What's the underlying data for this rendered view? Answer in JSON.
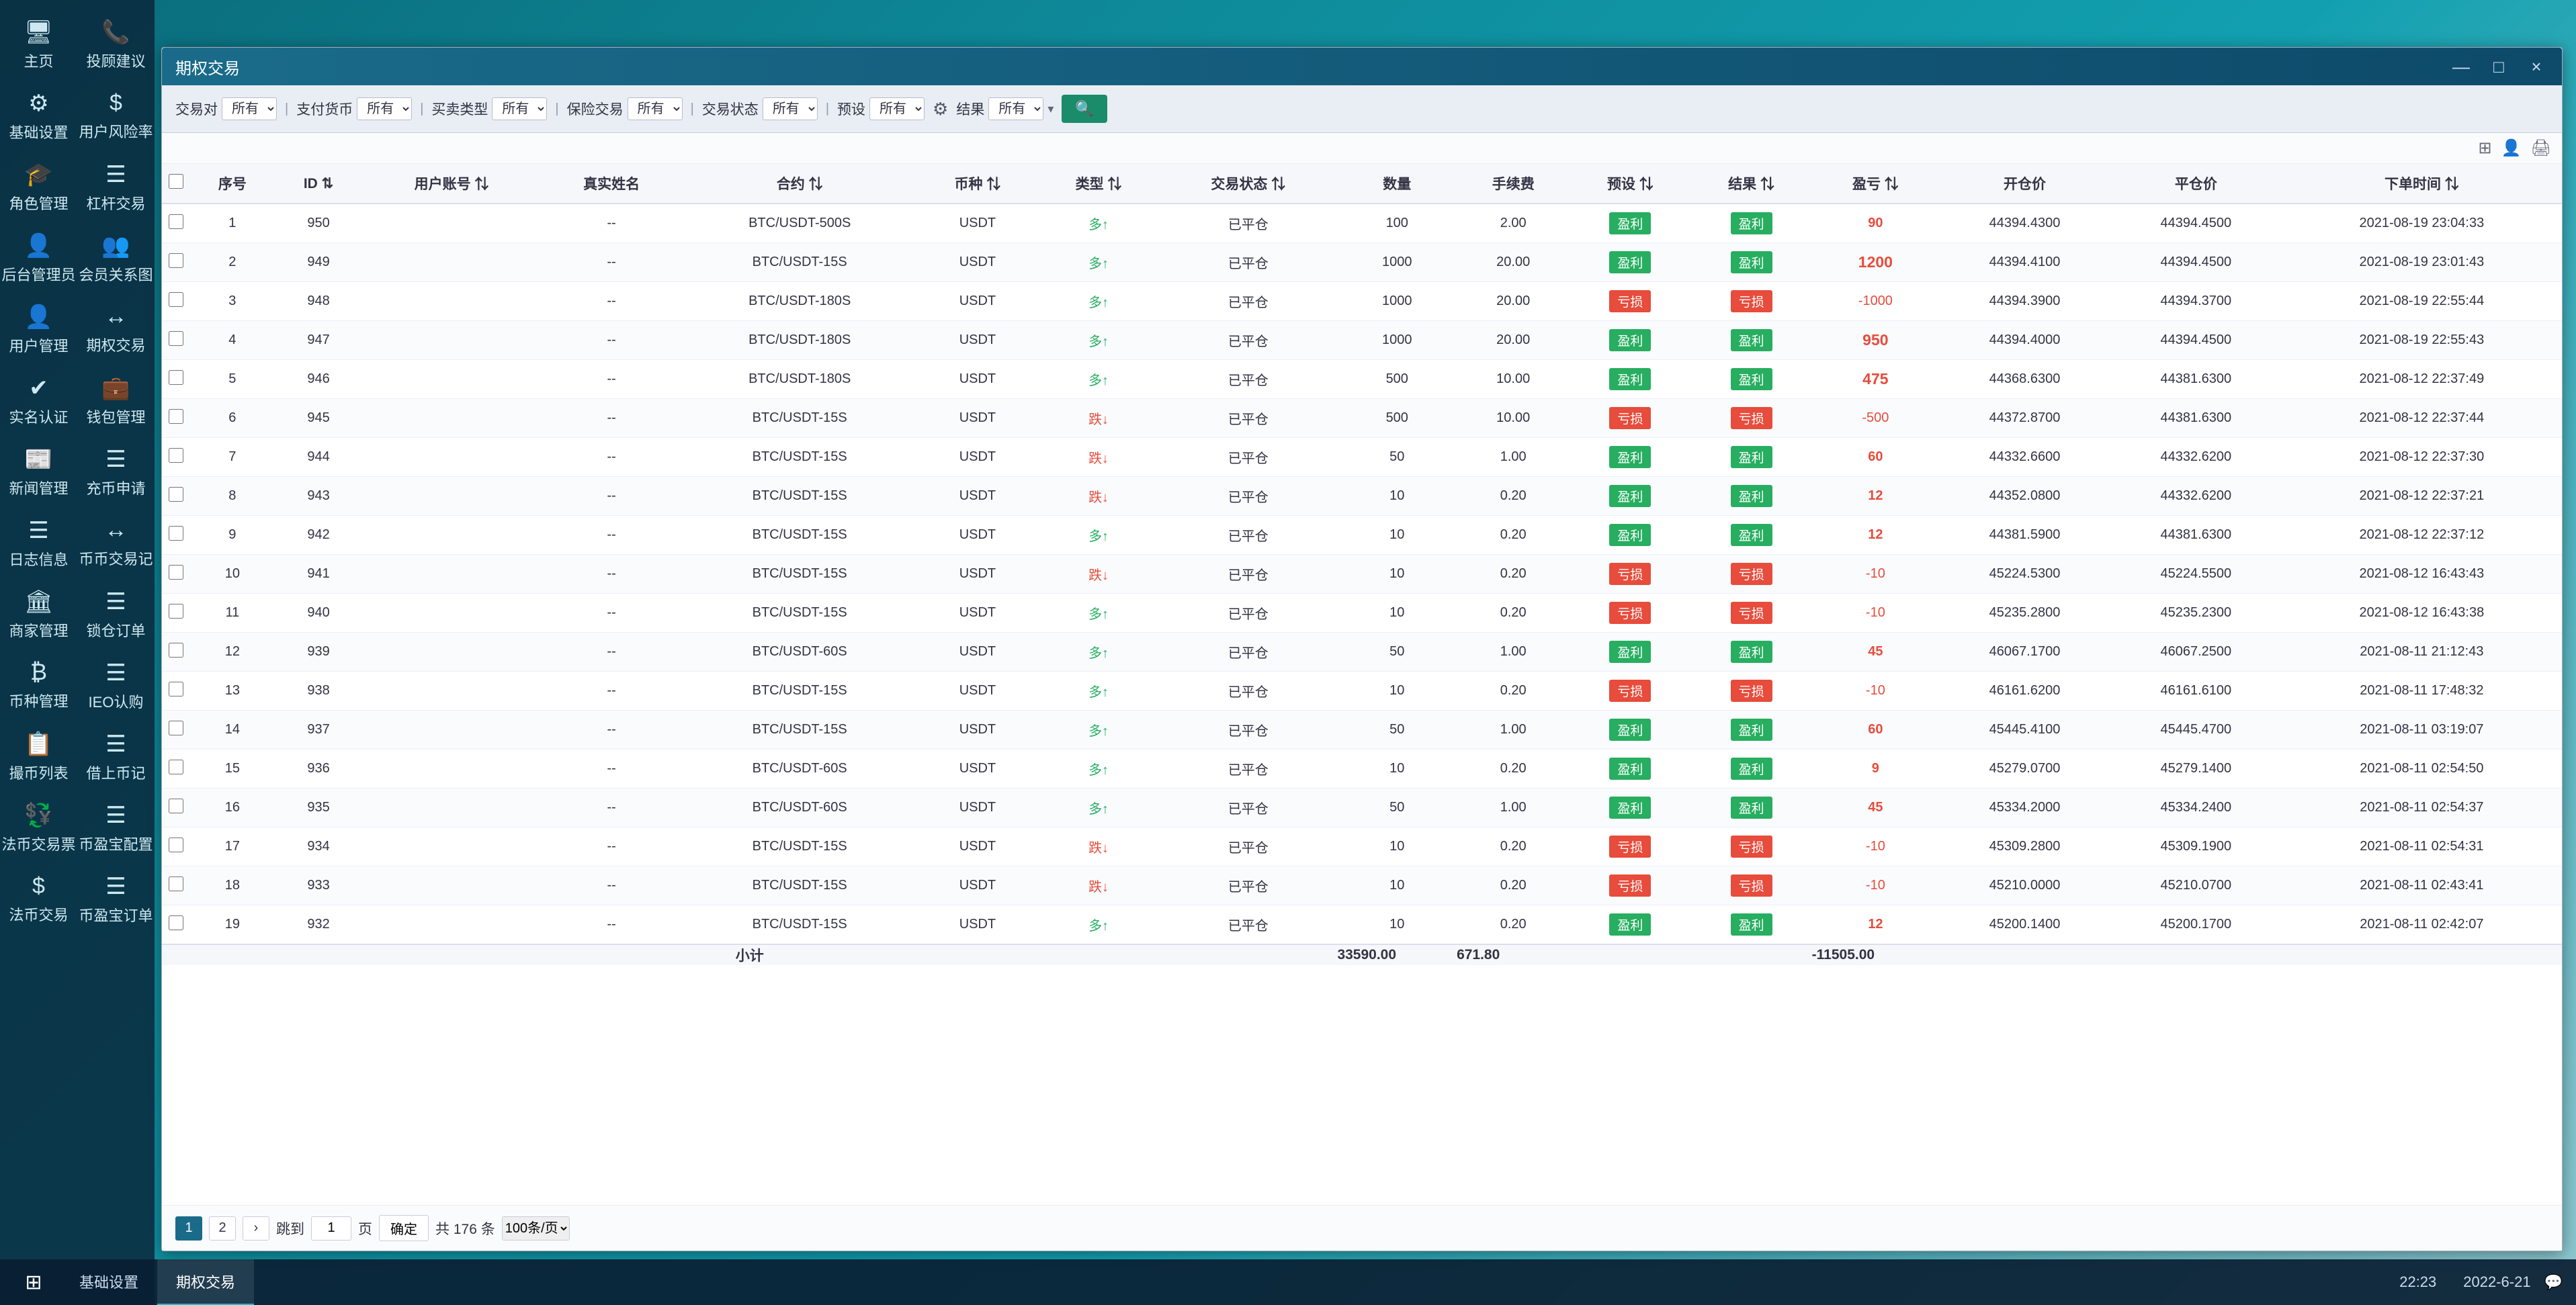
{
  "app": {
    "title": "基础设置",
    "time": "22:23",
    "date": "2022-6-21"
  },
  "sidebar": {
    "rows": [
      [
        {
          "id": "zhuye",
          "icon": "🖥",
          "label": "主页"
        },
        {
          "id": "touzi",
          "icon": "📞",
          "label": "投顾建议"
        }
      ],
      [
        {
          "id": "jichushezhi",
          "icon": "⚙",
          "label": "基础设置"
        },
        {
          "id": "yonghu",
          "icon": "$",
          "label": "用户风险率"
        }
      ],
      [
        {
          "id": "jiaose",
          "icon": "🎓",
          "label": "角色管理"
        },
        {
          "id": "ganggan",
          "icon": "☰",
          "label": "杠杆交易"
        }
      ],
      [
        {
          "id": "houtai",
          "icon": "👤",
          "label": "后台管理员"
        },
        {
          "id": "huiyuan",
          "icon": "👥",
          "label": "会员关系图"
        }
      ],
      [
        {
          "id": "yonghuguanli",
          "icon": "👤",
          "label": "用户管理"
        },
        {
          "id": "qihuo",
          "icon": "↔",
          "label": "期权交易"
        }
      ],
      [
        {
          "id": "shiming",
          "icon": "✔",
          "label": "实名认证"
        },
        {
          "id": "qianbao",
          "icon": "💼",
          "label": "钱包管理"
        }
      ],
      [
        {
          "id": "xinwen",
          "icon": "📰",
          "label": "新闻管理"
        },
        {
          "id": "chongbi",
          "icon": "☰",
          "label": "充币申请"
        }
      ],
      [
        {
          "id": "rizhi",
          "icon": "☰",
          "label": "日志信息"
        },
        {
          "id": "bibi",
          "icon": "↔",
          "label": "币币交易记"
        }
      ],
      [
        {
          "id": "shangjia",
          "icon": "🏛",
          "label": "商家管理"
        },
        {
          "id": "suoding",
          "icon": "☰",
          "label": "锁仓订单"
        }
      ],
      [
        {
          "id": "bizhong",
          "icon": "₿",
          "label": "币种管理"
        },
        {
          "id": "ieo",
          "icon": "☰",
          "label": "IEO认购"
        }
      ],
      [
        {
          "id": "bizhonglb",
          "icon": "📋",
          "label": "撮币列表"
        },
        {
          "id": "lianjie",
          "icon": "☰",
          "label": "借上币记"
        }
      ],
      [
        {
          "id": "fabi",
          "icon": "💱",
          "label": "法币交易票"
        },
        {
          "id": "pizhipz",
          "icon": "☰",
          "label": "币盈宝配置"
        }
      ],
      [
        {
          "id": "fabijy",
          "icon": "$",
          "label": "法币交易"
        },
        {
          "id": "bibd",
          "icon": "☰",
          "label": "币盈宝订单"
        }
      ]
    ]
  },
  "window": {
    "title": "期权交易",
    "controls": [
      "—",
      "□",
      "×"
    ]
  },
  "filters": [
    {
      "label": "交易对",
      "value": "所有",
      "id": "jiaoyidui"
    },
    {
      "label": "支付货币",
      "value": "所有",
      "id": "zhifuhuobi"
    },
    {
      "label": "买卖类型",
      "value": "所有",
      "id": "maimaileixing"
    },
    {
      "label": "保险交易",
      "value": "所有",
      "id": "baoxianjiaoy"
    },
    {
      "label": "交易状态",
      "value": "所有",
      "id": "jiaoyizhuangt"
    },
    {
      "label": "预设",
      "value": "所有",
      "id": "yushe"
    },
    {
      "label": "结果",
      "value": "所有",
      "id": "jieguo"
    }
  ],
  "table": {
    "columns": [
      "",
      "序号",
      "ID",
      "用户账号",
      "真实姓名",
      "合约",
      "币种",
      "类型",
      "交易状态",
      "数量",
      "手续费",
      "预设",
      "结果",
      "盈亏",
      "开仓价",
      "平仓价",
      "下单时间"
    ],
    "rows": [
      {
        "seq": 1,
        "id": 950,
        "account": "",
        "realname": "--",
        "contract": "BTC/USDT-500S",
        "coin": "USDT",
        "type": "多↑",
        "type_dir": "up",
        "status": "已平仓",
        "qty": 100,
        "fee": "2.00",
        "yushe": "盈利",
        "jieguo": "盈利",
        "jieguo_type": "profit",
        "pnl": 90,
        "pnl_type": "positive",
        "open": "44394.4300",
        "close": "44394.4500",
        "time": "2021-08-19 23:04:33"
      },
      {
        "seq": 2,
        "id": 949,
        "account": "",
        "realname": "--",
        "contract": "BTC/USDT-15S",
        "coin": "USDT",
        "type": "多↑",
        "type_dir": "up",
        "status": "已平仓",
        "qty": 1000,
        "fee": "20.00",
        "yushe": "盈利",
        "jieguo": "盈利",
        "jieguo_type": "profit",
        "pnl": 1200,
        "pnl_type": "positive_large",
        "open": "44394.4100",
        "close": "44394.4500",
        "time": "2021-08-19 23:01:43"
      },
      {
        "seq": 3,
        "id": 948,
        "account": "",
        "realname": "--",
        "contract": "BTC/USDT-180S",
        "coin": "USDT",
        "type": "多↑",
        "type_dir": "up",
        "status": "已平仓",
        "qty": 1000,
        "fee": "20.00",
        "yushe": "亏损",
        "jieguo": "亏损",
        "jieguo_type": "loss",
        "pnl": -1000,
        "pnl_type": "negative",
        "open": "44394.3900",
        "close": "44394.3700",
        "time": "2021-08-19 22:55:44"
      },
      {
        "seq": 4,
        "id": 947,
        "account": "",
        "realname": "--",
        "contract": "BTC/USDT-180S",
        "coin": "USDT",
        "type": "多↑",
        "type_dir": "up",
        "status": "已平仓",
        "qty": 1000,
        "fee": "20.00",
        "yushe": "盈利",
        "jieguo": "盈利",
        "jieguo_type": "profit",
        "pnl": 950,
        "pnl_type": "positive_large",
        "open": "44394.4000",
        "close": "44394.4500",
        "time": "2021-08-19 22:55:43"
      },
      {
        "seq": 5,
        "id": 946,
        "account": "",
        "realname": "--",
        "contract": "BTC/USDT-180S",
        "coin": "USDT",
        "type": "多↑",
        "type_dir": "up",
        "status": "已平仓",
        "qty": 500,
        "fee": "10.00",
        "yushe": "盈利",
        "jieguo": "盈利",
        "jieguo_type": "profit",
        "pnl": 475,
        "pnl_type": "positive_large",
        "open": "44368.6300",
        "close": "44381.6300",
        "time": "2021-08-12 22:37:49"
      },
      {
        "seq": 6,
        "id": 945,
        "account": "",
        "realname": "--",
        "contract": "BTC/USDT-15S",
        "coin": "USDT",
        "type": "跌↓",
        "type_dir": "down",
        "status": "已平仓",
        "qty": 500,
        "fee": "10.00",
        "yushe": "亏损",
        "jieguo": "亏损",
        "jieguo_type": "loss",
        "pnl": -500,
        "pnl_type": "negative",
        "open": "44372.8700",
        "close": "44381.6300",
        "time": "2021-08-12 22:37:44"
      },
      {
        "seq": 7,
        "id": 944,
        "account": "",
        "realname": "--",
        "contract": "BTC/USDT-15S",
        "coin": "USDT",
        "type": "跌↓",
        "type_dir": "down",
        "status": "已平仓",
        "qty": 50,
        "fee": "1.00",
        "yushe": "盈利",
        "jieguo": "盈利",
        "jieguo_type": "profit",
        "pnl": 60,
        "pnl_type": "positive",
        "open": "44332.6600",
        "close": "44332.6200",
        "time": "2021-08-12 22:37:30"
      },
      {
        "seq": 8,
        "id": 943,
        "account": "",
        "realname": "--",
        "contract": "BTC/USDT-15S",
        "coin": "USDT",
        "type": "跌↓",
        "type_dir": "down",
        "status": "已平仓",
        "qty": 10,
        "fee": "0.20",
        "yushe": "盈利",
        "jieguo": "盈利",
        "jieguo_type": "profit",
        "pnl": 12,
        "pnl_type": "positive",
        "open": "44352.0800",
        "close": "44332.6200",
        "time": "2021-08-12 22:37:21"
      },
      {
        "seq": 9,
        "id": 942,
        "account": "",
        "realname": "--",
        "contract": "BTC/USDT-15S",
        "coin": "USDT",
        "type": "多↑",
        "type_dir": "up",
        "status": "已平仓",
        "qty": 10,
        "fee": "0.20",
        "yushe": "盈利",
        "jieguo": "盈利",
        "jieguo_type": "profit",
        "pnl": 12,
        "pnl_type": "positive",
        "open": "44381.5900",
        "close": "44381.6300",
        "time": "2021-08-12 22:37:12"
      },
      {
        "seq": 10,
        "id": 941,
        "account": "",
        "realname": "--",
        "contract": "BTC/USDT-15S",
        "coin": "USDT",
        "type": "跌↓",
        "type_dir": "down",
        "status": "已平仓",
        "qty": 10,
        "fee": "0.20",
        "yushe": "亏损",
        "jieguo": "亏损",
        "jieguo_type": "loss",
        "pnl": -10,
        "pnl_type": "negative",
        "open": "45224.5300",
        "close": "45224.5500",
        "time": "2021-08-12 16:43:43"
      },
      {
        "seq": 11,
        "id": 940,
        "account": "",
        "realname": "--",
        "contract": "BTC/USDT-15S",
        "coin": "USDT",
        "type": "多↑",
        "type_dir": "up",
        "status": "已平仓",
        "qty": 10,
        "fee": "0.20",
        "yushe": "亏损",
        "jieguo": "亏损",
        "jieguo_type": "loss",
        "pnl": -10,
        "pnl_type": "negative",
        "open": "45235.2800",
        "close": "45235.2300",
        "time": "2021-08-12 16:43:38"
      },
      {
        "seq": 12,
        "id": 939,
        "account": "",
        "realname": "--",
        "contract": "BTC/USDT-60S",
        "coin": "USDT",
        "type": "多↑",
        "type_dir": "up",
        "status": "已平仓",
        "qty": 50,
        "fee": "1.00",
        "yushe": "盈利",
        "jieguo": "盈利",
        "jieguo_type": "profit",
        "pnl": 45,
        "pnl_type": "positive",
        "open": "46067.1700",
        "close": "46067.2500",
        "time": "2021-08-11 21:12:43"
      },
      {
        "seq": 13,
        "id": 938,
        "account": "",
        "realname": "--",
        "contract": "BTC/USDT-15S",
        "coin": "USDT",
        "type": "多↑",
        "type_dir": "up",
        "status": "已平仓",
        "qty": 10,
        "fee": "0.20",
        "yushe": "亏损",
        "jieguo": "亏损",
        "jieguo_type": "loss",
        "pnl": -10,
        "pnl_type": "negative",
        "open": "46161.6200",
        "close": "46161.6100",
        "time": "2021-08-11 17:48:32"
      },
      {
        "seq": 14,
        "id": 937,
        "account": "",
        "realname": "--",
        "contract": "BTC/USDT-15S",
        "coin": "USDT",
        "type": "多↑",
        "type_dir": "up",
        "status": "已平仓",
        "qty": 50,
        "fee": "1.00",
        "yushe": "盈利",
        "jieguo": "盈利",
        "jieguo_type": "profit",
        "pnl": 60,
        "pnl_type": "positive",
        "open": "45445.4100",
        "close": "45445.4700",
        "time": "2021-08-11 03:19:07"
      },
      {
        "seq": 15,
        "id": 936,
        "account": "",
        "realname": "--",
        "contract": "BTC/USDT-60S",
        "coin": "USDT",
        "type": "多↑",
        "type_dir": "up",
        "status": "已平仓",
        "qty": 10,
        "fee": "0.20",
        "yushe": "盈利",
        "jieguo": "盈利",
        "jieguo_type": "profit",
        "pnl": 9,
        "pnl_type": "positive",
        "open": "45279.0700",
        "close": "45279.1400",
        "time": "2021-08-11 02:54:50"
      },
      {
        "seq": 16,
        "id": 935,
        "account": "",
        "realname": "--",
        "contract": "BTC/USDT-60S",
        "coin": "USDT",
        "type": "多↑",
        "type_dir": "up",
        "status": "已平仓",
        "qty": 50,
        "fee": "1.00",
        "yushe": "盈利",
        "jieguo": "盈利",
        "jieguo_type": "profit",
        "pnl": 45,
        "pnl_type": "positive",
        "open": "45334.2000",
        "close": "45334.2400",
        "time": "2021-08-11 02:54:37"
      },
      {
        "seq": 17,
        "id": 934,
        "account": "",
        "realname": "--",
        "contract": "BTC/USDT-15S",
        "coin": "USDT",
        "type": "跌↓",
        "type_dir": "down",
        "status": "已平仓",
        "qty": 10,
        "fee": "0.20",
        "yushe": "亏损",
        "jieguo": "亏损",
        "jieguo_type": "loss",
        "pnl": -10,
        "pnl_type": "negative",
        "open": "45309.2800",
        "close": "45309.1900",
        "time": "2021-08-11 02:54:31"
      },
      {
        "seq": 18,
        "id": 933,
        "account": "",
        "realname": "--",
        "contract": "BTC/USDT-15S",
        "coin": "USDT",
        "type": "跌↓",
        "type_dir": "down",
        "status": "已平仓",
        "qty": 10,
        "fee": "0.20",
        "yushe": "亏损",
        "jieguo": "亏损",
        "jieguo_type": "loss",
        "pnl": -10,
        "pnl_type": "negative",
        "open": "45210.0000",
        "close": "45210.0700",
        "time": "2021-08-11 02:43:41"
      },
      {
        "seq": 19,
        "id": 932,
        "account": "",
        "realname": "--",
        "contract": "BTC/USDT-15S",
        "coin": "USDT",
        "type": "多↑",
        "type_dir": "up",
        "status": "已平仓",
        "qty": 10,
        "fee": "0.20",
        "yushe": "盈利",
        "jieguo": "盈利",
        "jieguo_type": "profit",
        "pnl": 12,
        "pnl_type": "positive",
        "open": "45200.1400",
        "close": "45200.1700",
        "time": "2021-08-11 02:42:07"
      }
    ],
    "subtotal": {
      "label": "小计",
      "qty_total": "33590.00",
      "fee_total": "671.80",
      "pnl_total": "-11505.00"
    }
  },
  "pagination": {
    "current": 1,
    "total_pages": 2,
    "total_records": "共 176 条",
    "per_page": "100条/页",
    "goto_label": "跳到",
    "page_label": "页",
    "confirm_label": "确定"
  },
  "taskbar": {
    "start_icon": "⊞",
    "items": [
      {
        "label": "基础设置",
        "active": false
      },
      {
        "label": "期权交易",
        "active": true
      }
    ],
    "chat_icon": "💬"
  }
}
